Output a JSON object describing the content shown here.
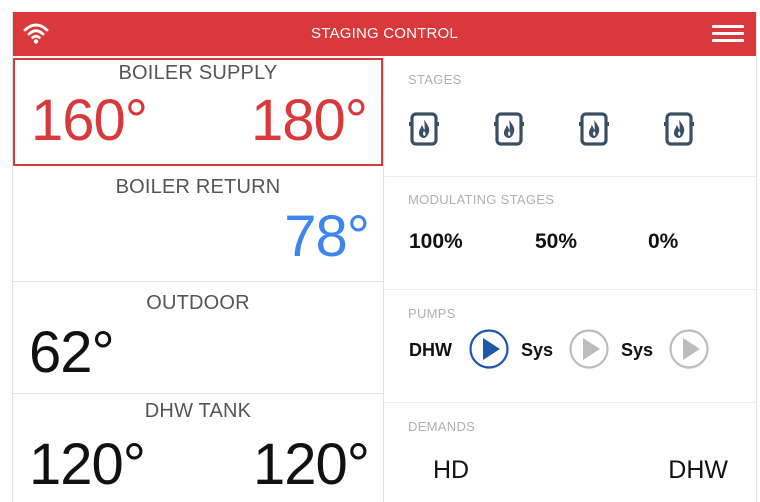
{
  "header": {
    "title": "STAGING CONTROL",
    "background": "#d9393b",
    "left_icon": "wifi-icon",
    "right_icon": "hamburger-menu-icon"
  },
  "readings": {
    "boiler_supply": {
      "label": "BOILER SUPPLY",
      "value_left": "160°",
      "value_right": "180°",
      "color": "#d9393b"
    },
    "boiler_return": {
      "label": "BOILER RETURN",
      "value": "78°",
      "color": "#3d86f0"
    },
    "outdoor": {
      "label": "OUTDOOR",
      "value": "62°"
    },
    "dhw_tank": {
      "label": "DHW TANK",
      "value_left": "120°",
      "value_right": "120°"
    }
  },
  "stages": {
    "label": "STAGES",
    "icons": [
      "boiler-flame-icon",
      "boiler-flame-icon",
      "boiler-flame-icon",
      "boiler-flame-icon"
    ]
  },
  "modulating": {
    "label": "MODULATING STAGES",
    "values": [
      "100%",
      "50%",
      "0%"
    ]
  },
  "pumps": {
    "label": "PUMPS",
    "items": [
      {
        "name": "DHW",
        "state": "on",
        "icon": "play-icon",
        "color": "#1f58a8"
      },
      {
        "name": "Sys",
        "state": "off",
        "icon": "play-icon",
        "color": "#bdbdbd"
      },
      {
        "name": "Sys",
        "state": "off",
        "icon": "play-icon",
        "color": "#bdbdbd"
      }
    ]
  },
  "demands": {
    "label": "DEMANDS",
    "items": [
      "HD",
      "DHW"
    ]
  }
}
